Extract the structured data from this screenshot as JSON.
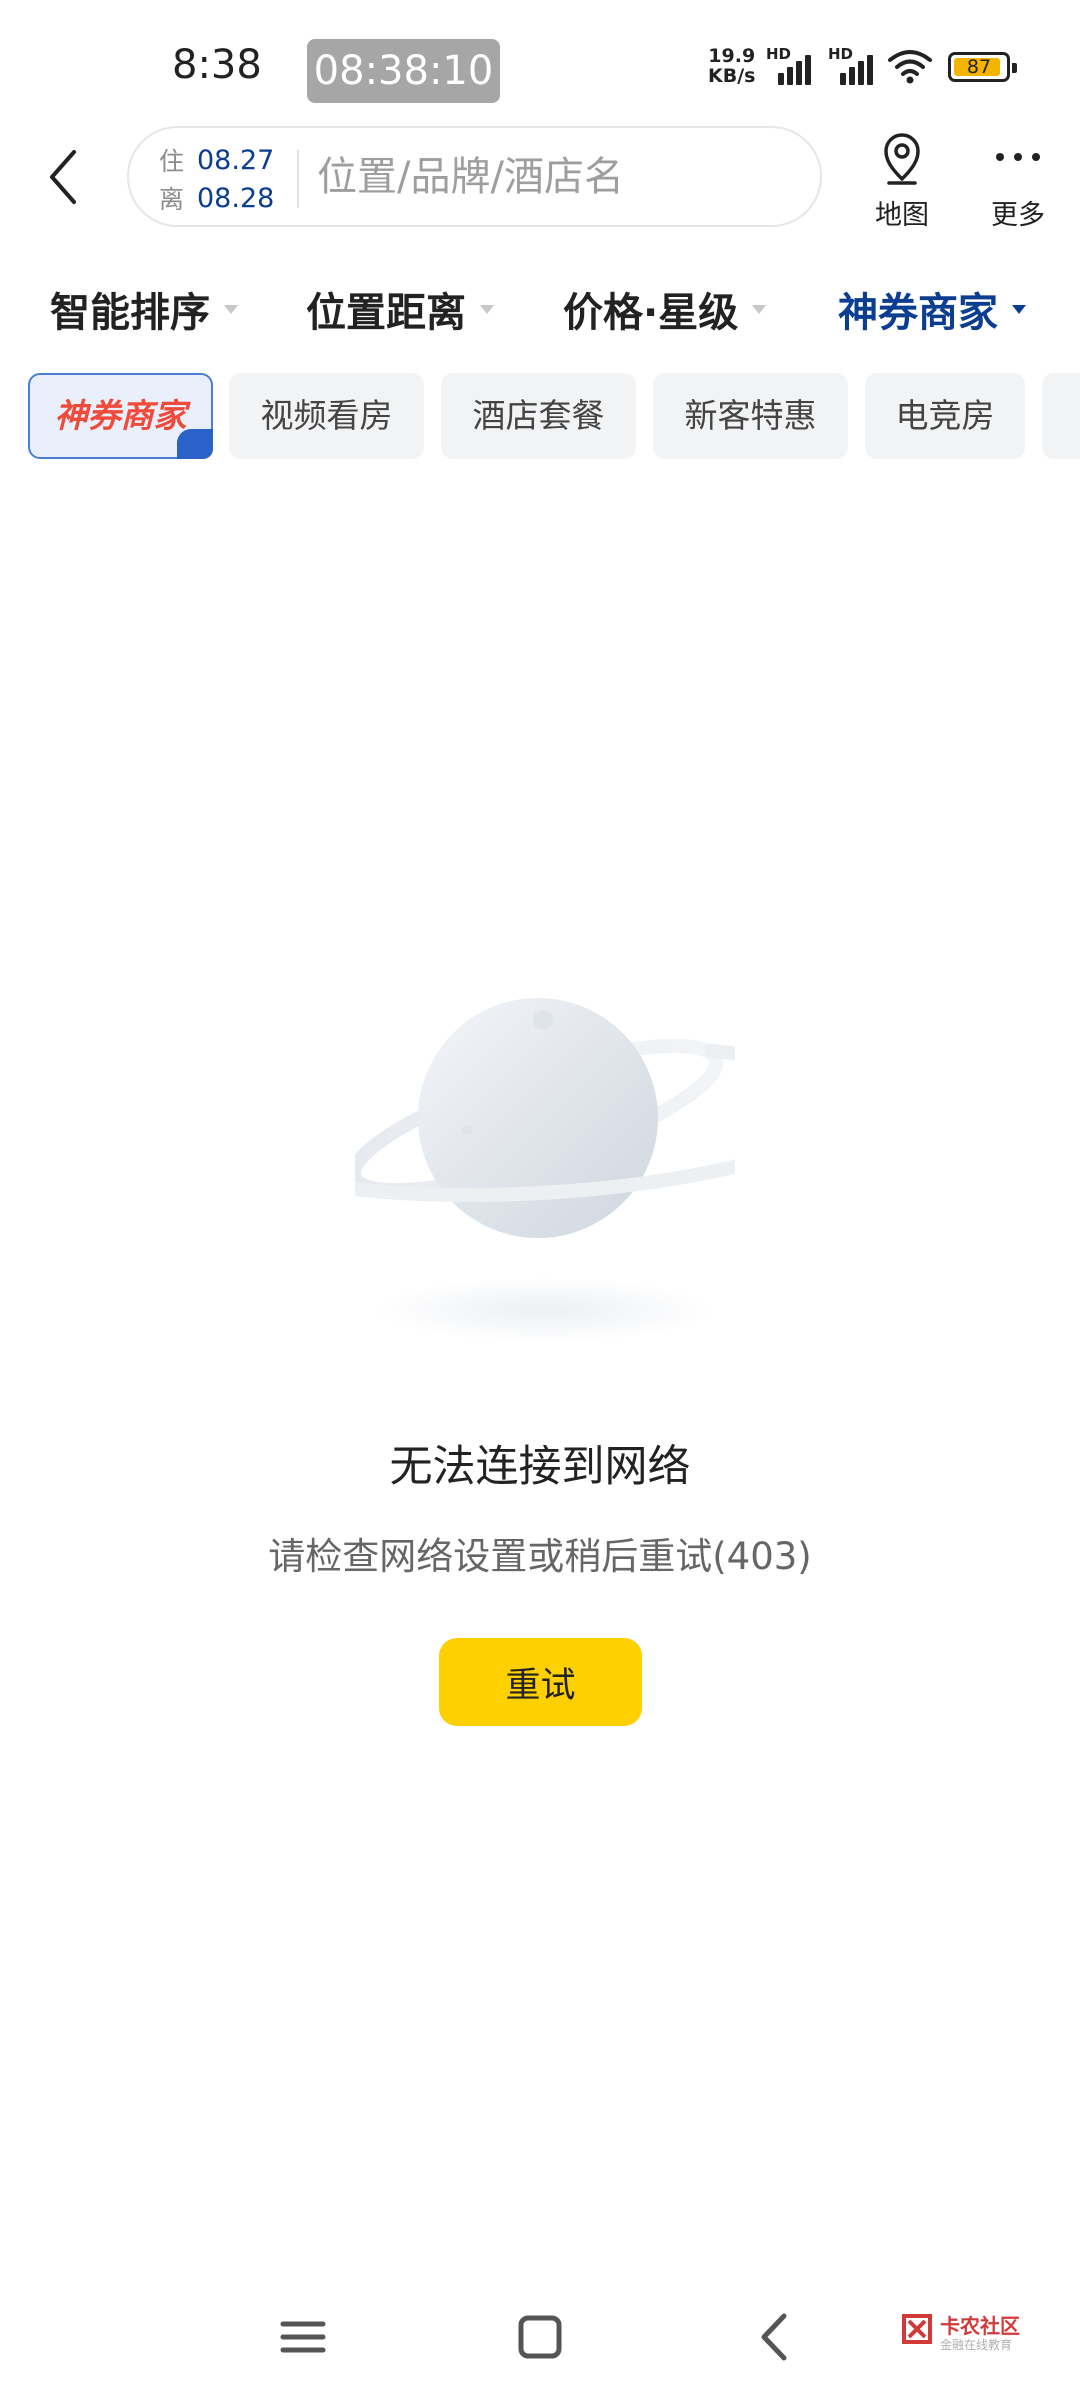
{
  "status_bar": {
    "time": "8:38",
    "clock_overlay": "08:38:10",
    "net_speed_value": "19.9",
    "net_speed_unit": "KB/s",
    "sim1_label": "HD",
    "sim2_label": "HD",
    "battery_level": "87"
  },
  "header": {
    "check_in_label": "住",
    "check_in_date": "08.27",
    "check_out_label": "离",
    "check_out_date": "08.28",
    "search_placeholder": "位置/品牌/酒店名",
    "map_label": "地图",
    "more_label": "更多"
  },
  "filters": [
    {
      "label": "智能排序",
      "active": false
    },
    {
      "label": "位置距离",
      "active": false
    },
    {
      "label": "价格·星级",
      "active": false
    },
    {
      "label": "神券商家",
      "active": true
    }
  ],
  "chips": [
    {
      "label": "神券商家",
      "selected": true
    },
    {
      "label": "视频看房",
      "selected": false
    },
    {
      "label": "酒店套餐",
      "selected": false
    },
    {
      "label": "新客特惠",
      "selected": false
    },
    {
      "label": "电竞房",
      "selected": false
    }
  ],
  "error": {
    "title": "无法连接到网络",
    "description": "请检查网络设置或稍后重试(403)",
    "retry_label": "重试"
  },
  "watermark": {
    "text": "卡农社区",
    "subtext": "金融在线教育"
  },
  "colors": {
    "accent_blue": "#0b3d91",
    "retry_yellow": "#ffd000",
    "chip_bg": "#f2f3f5"
  }
}
